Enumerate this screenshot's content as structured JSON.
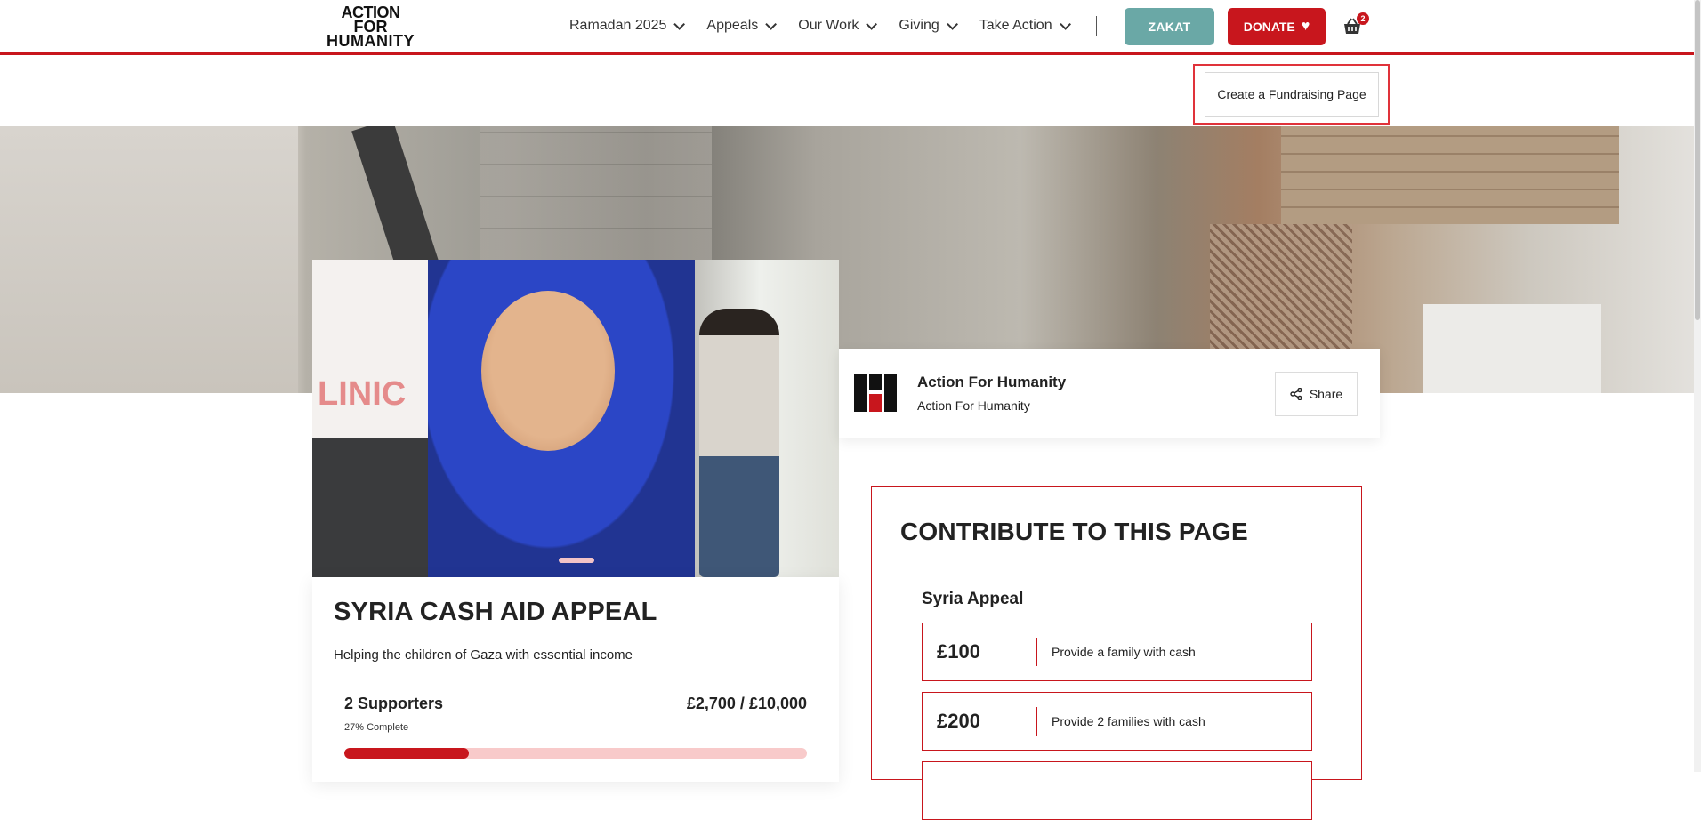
{
  "header": {
    "logo": {
      "line1": "ACTION",
      "line2": "FOR",
      "line3": "HUMANITY"
    },
    "nav": [
      {
        "label": "Ramadan 2025"
      },
      {
        "label": "Appeals"
      },
      {
        "label": "Our Work"
      },
      {
        "label": "Giving"
      },
      {
        "label": "Take Action"
      }
    ],
    "zakat_label": "ZAKAT",
    "donate_label": "DONATE",
    "cart_count": "2",
    "icons": {
      "cart": "basket-icon",
      "donate": "heart-icon"
    }
  },
  "create_page_label": "Create a Fundraising Page",
  "appeal": {
    "title": "SYRIA CASH AID APPEAL",
    "subtitle": "Helping the children of Gaza with essential income",
    "supporters": "2 Supporters",
    "amount": "£2,700 / £10,000",
    "percent_label": "27% Complete",
    "progress_fraction": 0.27
  },
  "organizer": {
    "name": "Action For Humanity",
    "sub": "Action For Humanity",
    "share_label": "Share"
  },
  "contribute": {
    "heading": "CONTRIBUTE TO THIS PAGE",
    "appeal_name": "Syria Appeal",
    "options": [
      {
        "price": "£100",
        "desc": "Provide a family with cash"
      },
      {
        "price": "£200",
        "desc": "Provide 2 families with cash"
      }
    ]
  },
  "colors": {
    "brand_red": "#c8161d",
    "zakat_teal": "#6aa8a6"
  }
}
